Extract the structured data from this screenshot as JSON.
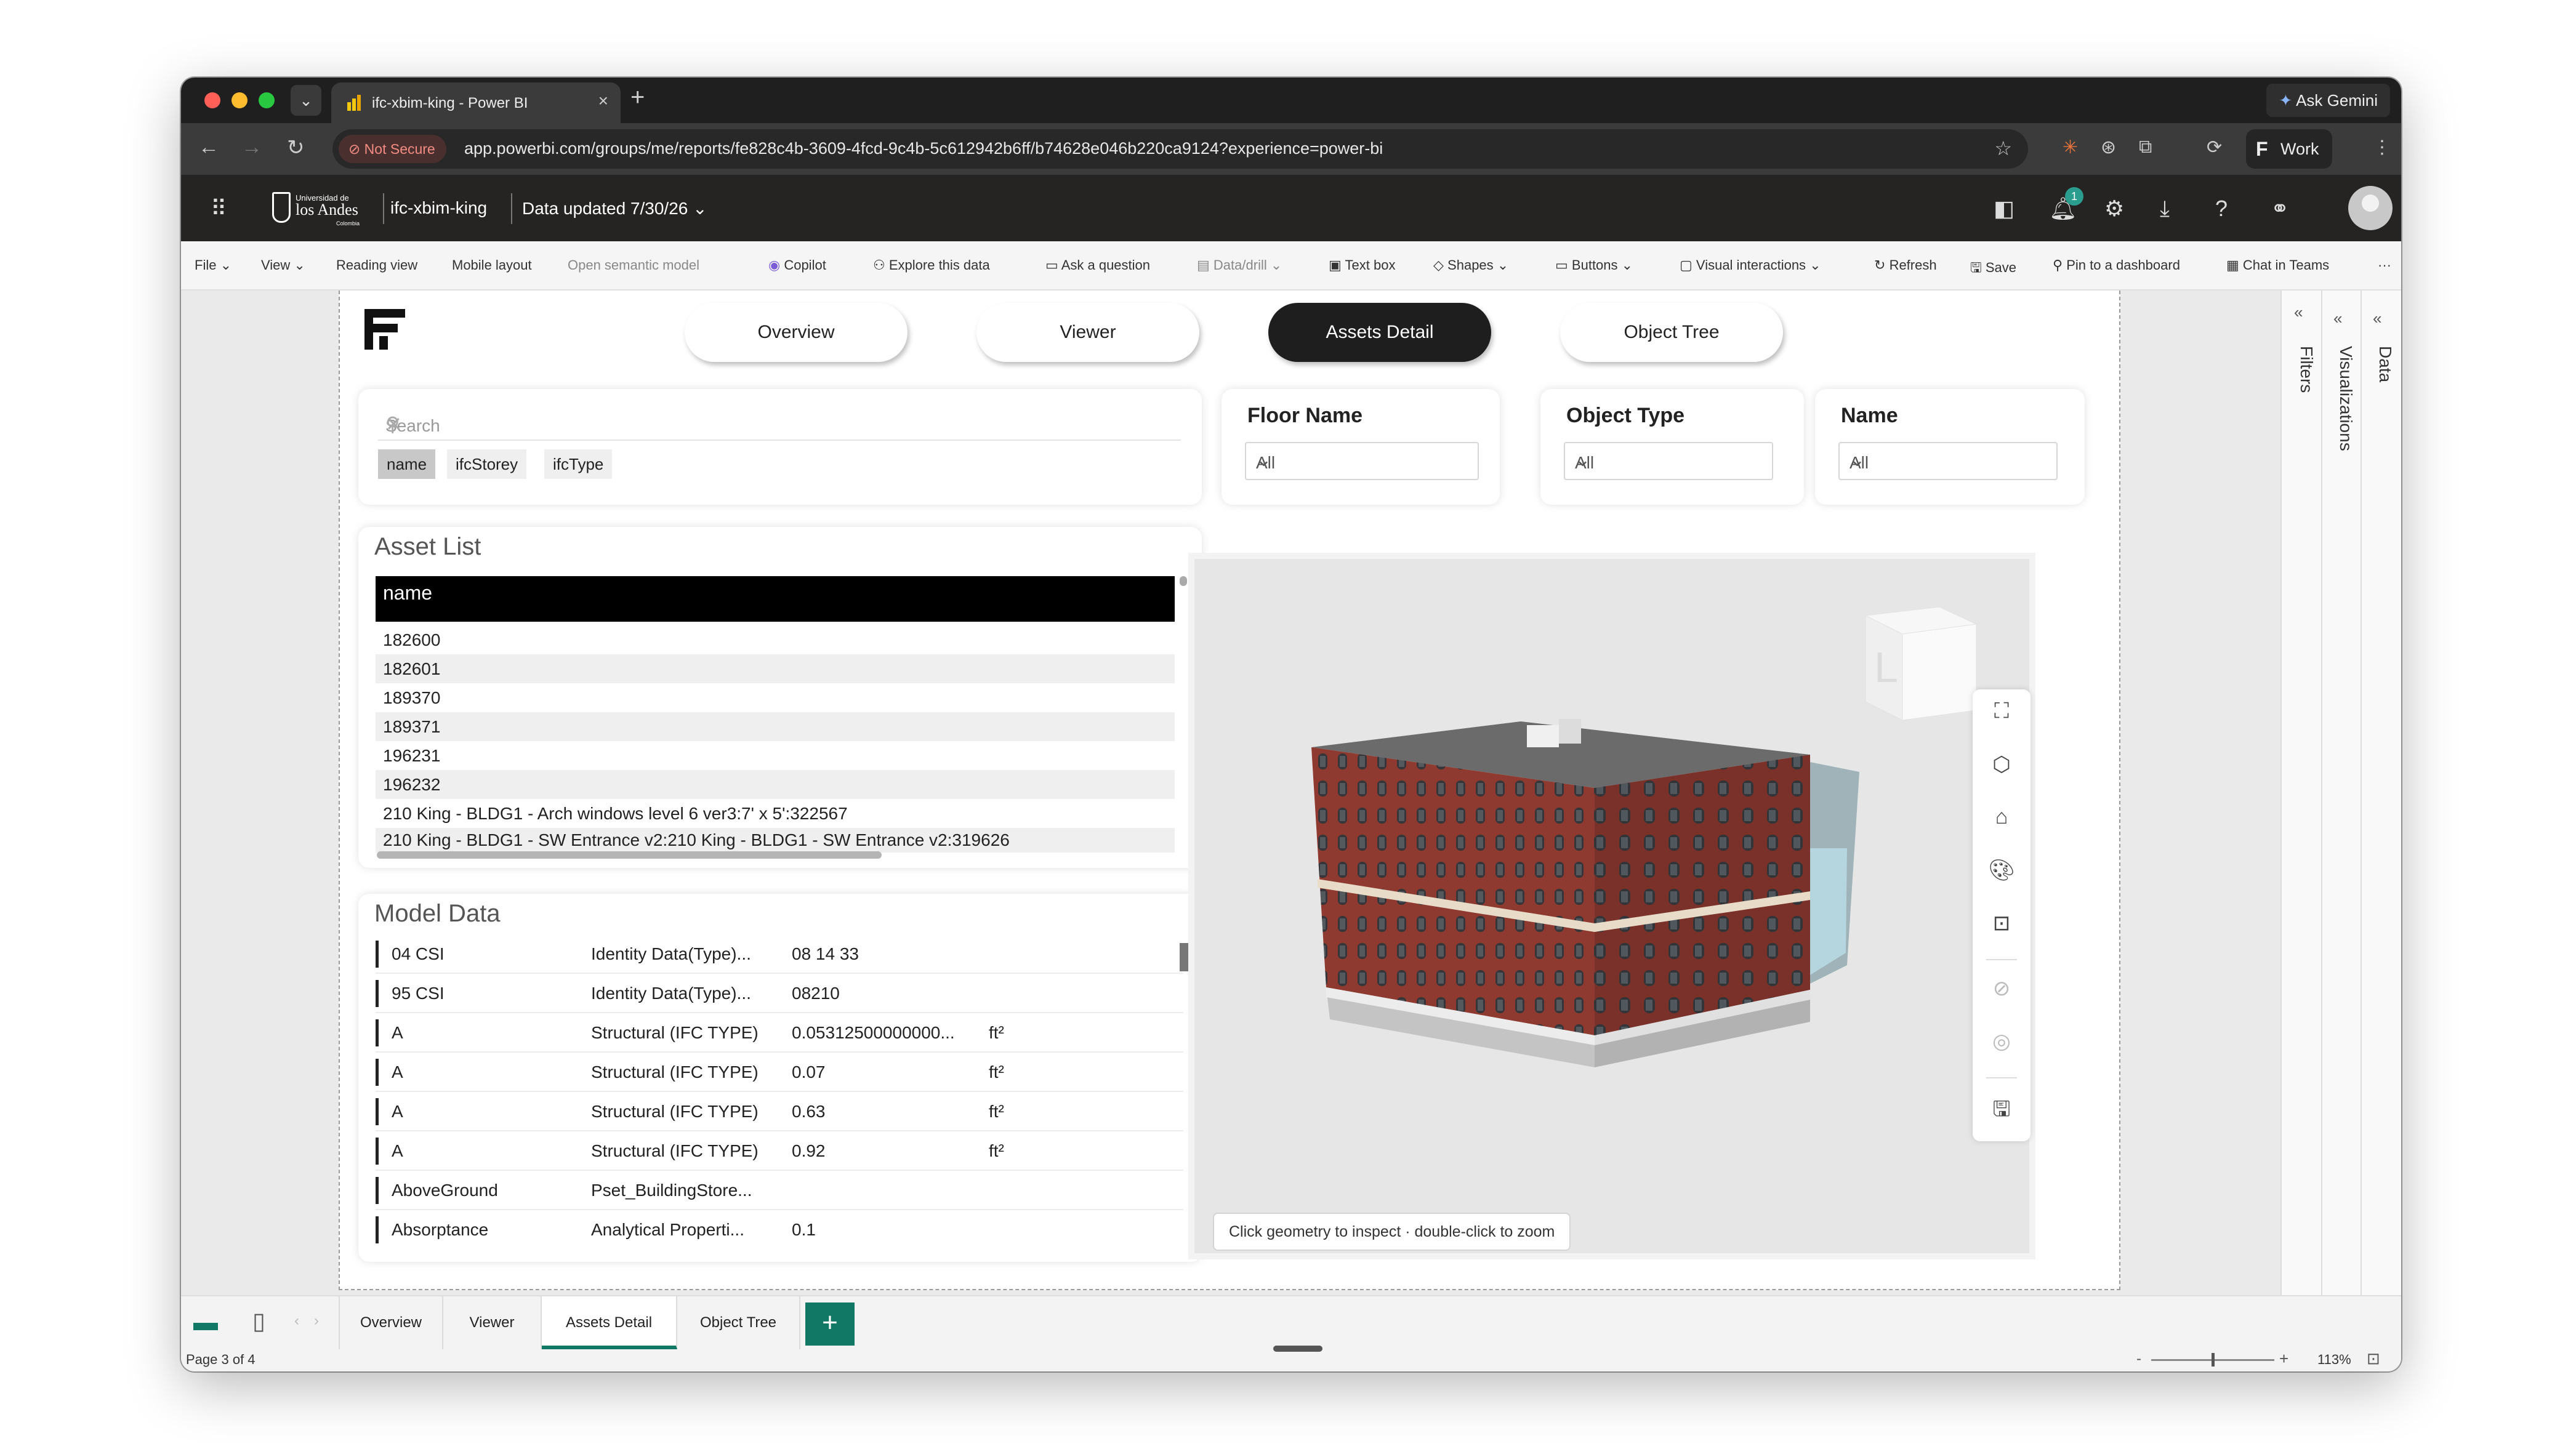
{
  "browser": {
    "tab_title": "ifc-xbim-king - Power BI",
    "security": "Not Secure",
    "url": "app.powerbi.com/groups/me/reports/fe828c4b-3609-4fcd-9c4b-5c612942b6ff/b74628e046b220ca9124?experience=power-bi",
    "ask_gemini": "Ask Gemini",
    "profile": "Work"
  },
  "header": {
    "org_line1": "Universidad de",
    "org_line2": "los Andes",
    "org_line3": "Colombia",
    "report_name": "ifc-xbim-king",
    "data_updated": "Data updated 7/30/26",
    "notification_count": "1"
  },
  "ribbon": {
    "file": "File",
    "view": "View",
    "reading_view": "Reading view",
    "mobile_layout": "Mobile layout",
    "open_semantic_model": "Open semantic model",
    "copilot": "Copilot",
    "explore": "Explore this data",
    "ask_question": "Ask a question",
    "data_drill": "Data/drill",
    "text_box": "Text box",
    "shapes": "Shapes",
    "buttons": "Buttons",
    "visual_interactions": "Visual interactions",
    "refresh": "Refresh",
    "save": "Save",
    "pin": "Pin to a dashboard",
    "chat_teams": "Chat in Teams",
    "more": "···"
  },
  "nav": {
    "overview": "Overview",
    "viewer": "Viewer",
    "assets_detail": "Assets Detail",
    "object_tree": "Object Tree"
  },
  "search": {
    "placeholder": "Search",
    "chips": [
      "name",
      "ifcStorey",
      "ifcType"
    ]
  },
  "slicers": {
    "floor": {
      "title": "Floor Name",
      "value": "All"
    },
    "type": {
      "title": "Object Type",
      "value": "All"
    },
    "name": {
      "title": "Name",
      "value": "All"
    }
  },
  "asset_list": {
    "title": "Asset List",
    "header": "name",
    "rows": [
      "182600",
      "182601",
      "189370",
      "189371",
      "196231",
      "196232",
      "210 King - BLDG1 - Arch windows level 6 ver3:7' x 5':322567",
      "210 King - BLDG1 - SW Entrance v2:210 King - BLDG1 - SW Entrance v2:319626"
    ]
  },
  "model_data": {
    "title": "Model Data",
    "rows": [
      {
        "name": "04 CSI",
        "group": "Identity Data(Type)...",
        "value": "08 14 33",
        "unit": ""
      },
      {
        "name": "95 CSI",
        "group": "Identity Data(Type)...",
        "value": "08210",
        "unit": ""
      },
      {
        "name": "A",
        "group": "Structural (IFC TYPE)",
        "value": "0.05312500000000...",
        "unit": "ft²"
      },
      {
        "name": "A",
        "group": "Structural (IFC TYPE)",
        "value": "0.07",
        "unit": "ft²"
      },
      {
        "name": "A",
        "group": "Structural (IFC TYPE)",
        "value": "0.63",
        "unit": "ft²"
      },
      {
        "name": "A",
        "group": "Structural (IFC TYPE)",
        "value": "0.92",
        "unit": "ft²"
      },
      {
        "name": "AboveGround",
        "group": "Pset_BuildingStore...",
        "value": "",
        "unit": ""
      },
      {
        "name": "Absorptance",
        "group": "Analytical Properti...",
        "value": "0.1",
        "unit": ""
      }
    ]
  },
  "viewer": {
    "hint": "Click geometry to inspect · double-click to zoom",
    "cube_label": "L"
  },
  "panes": {
    "filters": "Filters",
    "visualizations": "Visualizations",
    "data": "Data"
  },
  "page_tabs": [
    "Overview",
    "Viewer",
    "Assets Detail",
    "Object Tree"
  ],
  "status": {
    "page": "Page 3 of 4",
    "zoom": "113%"
  },
  "colors": {
    "accent": "#117865",
    "active_button": "#1e1e1e",
    "brick": "#8e3a30"
  }
}
